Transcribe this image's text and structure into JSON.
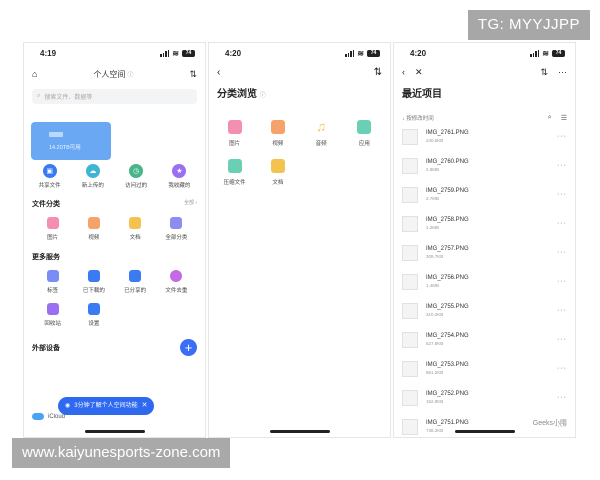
{
  "watermarks": {
    "top_right": "TG: MYYJJPP",
    "bottom_left": "www.kaiyunesports-zone.com"
  },
  "status": {
    "p1_time": "4:19",
    "p2_time": "4:20",
    "p3_time": "4:20",
    "battery": "74"
  },
  "screen1": {
    "title": "个人空间",
    "title_info_icon": "info-icon",
    "search_placeholder": "搜索文件、数据等",
    "cloud_card": {
      "badge": "●●●",
      "caption": "14.20TB可用"
    },
    "quick": [
      {
        "label": "共享文件",
        "icon": "share-folder-icon",
        "color": "#3a7bf2"
      },
      {
        "label": "新上传的",
        "icon": "upload-cloud-icon",
        "color": "#3fb5d6"
      },
      {
        "label": "访问过的",
        "icon": "clock-icon",
        "color": "#48b58a"
      },
      {
        "label": "我收藏的",
        "icon": "star-icon",
        "color": "#9a6ff2"
      }
    ],
    "categories": {
      "title": "文件分类",
      "more": "全部 ›",
      "items": [
        {
          "label": "图片",
          "color": "#f38fb0"
        },
        {
          "label": "视频",
          "color": "#f5a36a"
        },
        {
          "label": "文档",
          "color": "#f4c24f"
        },
        {
          "label": "全部分类",
          "color": "#8b8ef0"
        }
      ]
    },
    "services": {
      "title": "更多服务",
      "items": [
        {
          "label": "标签",
          "color": "#7a8cf5"
        },
        {
          "label": "已下载的",
          "color": "#3a7bf2"
        },
        {
          "label": "已分享的",
          "color": "#3a7bf2"
        },
        {
          "label": "文件去重",
          "color": "#c36ae6"
        },
        {
          "label": "回收站",
          "color": "#9a6ff2"
        },
        {
          "label": "设置",
          "color": "#3a7bf2"
        }
      ]
    },
    "external": {
      "title": "外部设备",
      "icloud": "iCloud"
    },
    "toast": "3分钟了解个人空间功能",
    "fab_label": "+"
  },
  "screen2": {
    "title": "分类浏览",
    "items": [
      {
        "label": "图片",
        "color": "#f38fb0"
      },
      {
        "label": "视频",
        "color": "#f5a36a"
      },
      {
        "label": "音频",
        "color": "#f4c24f"
      },
      {
        "label": "应用",
        "color": "#6ad0b5"
      },
      {
        "label": "压缩文件",
        "color": "#6ad0b5"
      },
      {
        "label": "文档",
        "color": "#f4c24f"
      }
    ]
  },
  "screen3": {
    "title": "最近项目",
    "sort_label": "按修改时间",
    "files": [
      {
        "name": "IMG_2761.PNG",
        "size": "240.6KB"
      },
      {
        "name": "IMG_2760.PNG",
        "size": "2.8MB"
      },
      {
        "name": "IMG_2759.PNG",
        "size": "2.7MB"
      },
      {
        "name": "IMG_2758.PNG",
        "size": "1.2MB"
      },
      {
        "name": "IMG_2757.PNG",
        "size": "309.7KB"
      },
      {
        "name": "IMG_2756.PNG",
        "size": "1.4MB"
      },
      {
        "name": "IMG_2755.PNG",
        "size": "310.2KB"
      },
      {
        "name": "IMG_2754.PNG",
        "size": "527.8KB"
      },
      {
        "name": "IMG_2753.PNG",
        "size": "861.2KB"
      },
      {
        "name": "IMG_2752.PNG",
        "size": "152.8KB"
      },
      {
        "name": "IMG_2751.PNG",
        "size": "738.2KB"
      }
    ],
    "watermark": "Geeks小隋"
  }
}
